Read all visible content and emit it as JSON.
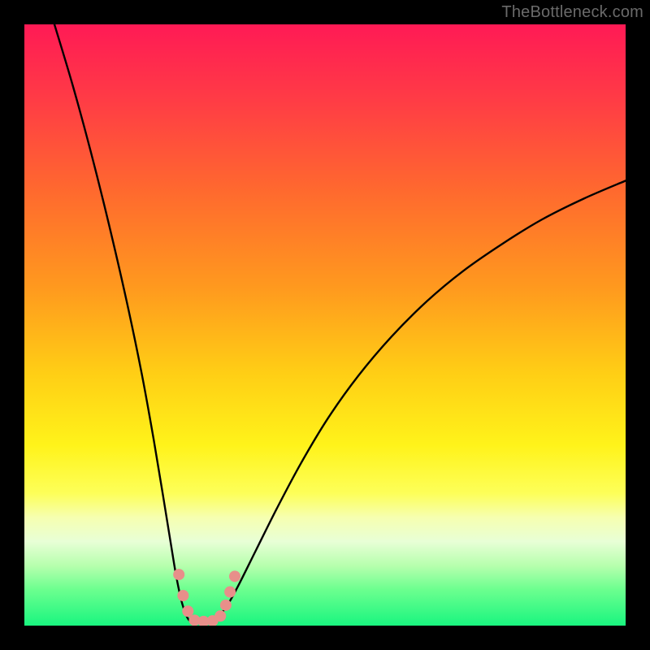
{
  "watermark": "TheBottleneck.com",
  "chart_data": {
    "type": "line",
    "title": "",
    "xlabel": "",
    "ylabel": "",
    "xlim": [
      0,
      100
    ],
    "ylim": [
      0,
      100
    ],
    "grid": false,
    "legend": false,
    "gradient_stops": [
      {
        "offset": 0.0,
        "color": "#ff1a55"
      },
      {
        "offset": 0.12,
        "color": "#ff3a46"
      },
      {
        "offset": 0.28,
        "color": "#ff6a2e"
      },
      {
        "offset": 0.44,
        "color": "#ff9a1e"
      },
      {
        "offset": 0.58,
        "color": "#ffce15"
      },
      {
        "offset": 0.7,
        "color": "#fff31a"
      },
      {
        "offset": 0.78,
        "color": "#fdff59"
      },
      {
        "offset": 0.82,
        "color": "#f6ffb0"
      },
      {
        "offset": 0.86,
        "color": "#e8ffd6"
      },
      {
        "offset": 0.9,
        "color": "#b7ffae"
      },
      {
        "offset": 0.94,
        "color": "#6cff8f"
      },
      {
        "offset": 1.0,
        "color": "#19f57f"
      }
    ],
    "series": [
      {
        "name": "curve",
        "stroke": "#000000",
        "stroke_width": 2.4,
        "points": [
          {
            "x": 5.0,
            "y": 100.0
          },
          {
            "x": 8.0,
            "y": 90.0
          },
          {
            "x": 11.0,
            "y": 79.0
          },
          {
            "x": 14.0,
            "y": 67.0
          },
          {
            "x": 17.0,
            "y": 54.0
          },
          {
            "x": 19.5,
            "y": 42.0
          },
          {
            "x": 21.5,
            "y": 31.0
          },
          {
            "x": 23.0,
            "y": 22.0
          },
          {
            "x": 24.3,
            "y": 14.0
          },
          {
            "x": 25.3,
            "y": 8.0
          },
          {
            "x": 26.3,
            "y": 3.5
          },
          {
            "x": 27.5,
            "y": 0.8
          },
          {
            "x": 29.5,
            "y": 0.6
          },
          {
            "x": 31.5,
            "y": 0.9
          },
          {
            "x": 33.5,
            "y": 3.0
          },
          {
            "x": 35.5,
            "y": 6.5
          },
          {
            "x": 38.5,
            "y": 12.5
          },
          {
            "x": 42.0,
            "y": 19.5
          },
          {
            "x": 46.0,
            "y": 27.0
          },
          {
            "x": 50.5,
            "y": 34.5
          },
          {
            "x": 55.5,
            "y": 41.5
          },
          {
            "x": 61.0,
            "y": 48.0
          },
          {
            "x": 67.0,
            "y": 54.0
          },
          {
            "x": 73.0,
            "y": 59.0
          },
          {
            "x": 79.5,
            "y": 63.5
          },
          {
            "x": 86.0,
            "y": 67.5
          },
          {
            "x": 93.0,
            "y": 71.0
          },
          {
            "x": 100.0,
            "y": 74.0
          }
        ]
      }
    ],
    "markers": [
      {
        "x": 25.7,
        "y": 8.5,
        "r": 7
      },
      {
        "x": 26.4,
        "y": 5.0,
        "r": 7
      },
      {
        "x": 27.2,
        "y": 2.4,
        "r": 7
      },
      {
        "x": 28.3,
        "y": 0.9,
        "r": 7
      },
      {
        "x": 29.8,
        "y": 0.7,
        "r": 7
      },
      {
        "x": 31.3,
        "y": 0.8,
        "r": 7
      },
      {
        "x": 32.6,
        "y": 1.6,
        "r": 7
      },
      {
        "x": 33.5,
        "y": 3.4,
        "r": 7
      },
      {
        "x": 34.2,
        "y": 5.6,
        "r": 7
      },
      {
        "x": 35.0,
        "y": 8.2,
        "r": 7
      }
    ],
    "marker_style": {
      "fill": "#e88f8a",
      "stroke": "#d97a75",
      "stroke_width": 0
    }
  }
}
